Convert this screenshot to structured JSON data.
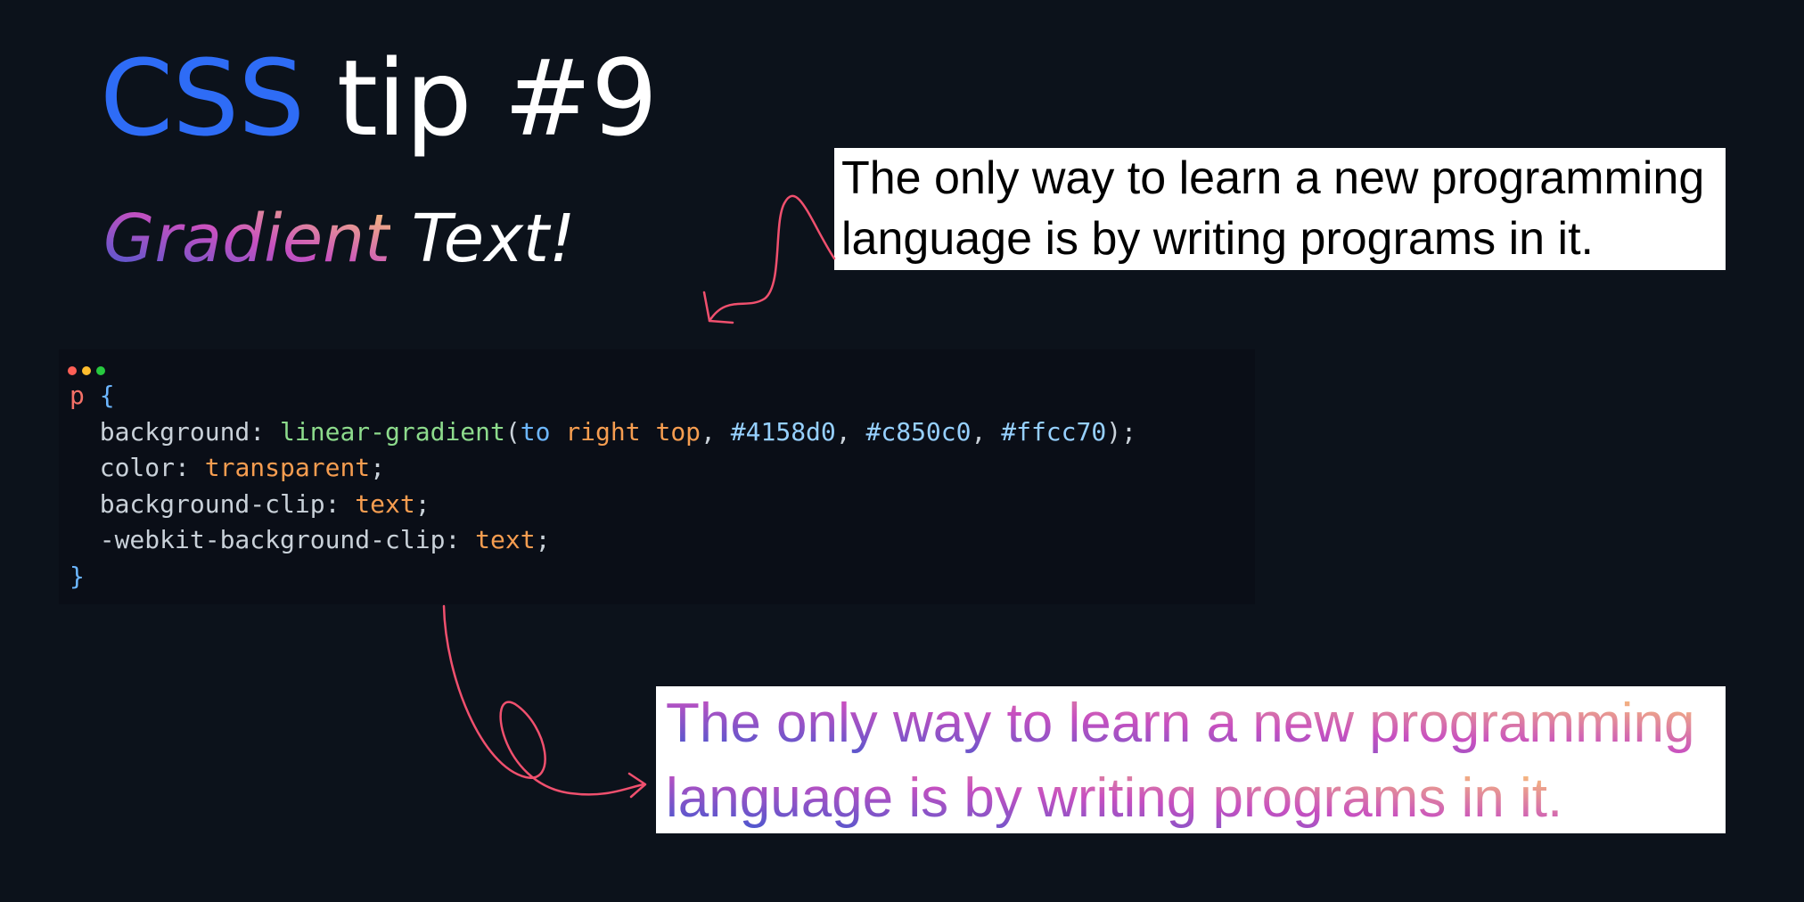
{
  "title": {
    "accent": "CSS",
    "rest": "tip #9"
  },
  "subtitle": {
    "gradient_word": "Gradient",
    "rest": "Text!"
  },
  "quote": {
    "line1": "The only way to learn a new programming",
    "line2": "language is by writing programs in it."
  },
  "code": {
    "selector": "p",
    "open_brace": "{",
    "close_brace": "}",
    "lines": [
      {
        "prop": "background",
        "parts": [
          {
            "text": "linear-gradient",
            "kind": "fn"
          },
          {
            "text": "(",
            "kind": "punc"
          },
          {
            "text": "to",
            "kind": "kw"
          },
          {
            "text": " right top",
            "kind": "val"
          },
          {
            "text": ", ",
            "kind": "punc"
          },
          {
            "text": "#4158d0",
            "kind": "hex"
          },
          {
            "text": ", ",
            "kind": "punc"
          },
          {
            "text": "#c850c0",
            "kind": "hex"
          },
          {
            "text": ", ",
            "kind": "punc"
          },
          {
            "text": "#ffcc70",
            "kind": "hex"
          },
          {
            "text": ");",
            "kind": "punc"
          }
        ]
      },
      {
        "prop": "color",
        "parts": [
          {
            "text": "transparent",
            "kind": "val"
          },
          {
            "text": ";",
            "kind": "punc"
          }
        ]
      },
      {
        "prop": "background-clip",
        "parts": [
          {
            "text": "text",
            "kind": "val"
          },
          {
            "text": ";",
            "kind": "punc"
          }
        ]
      },
      {
        "prop": "-webkit-background-clip",
        "parts": [
          {
            "text": "text",
            "kind": "val"
          },
          {
            "text": ";",
            "kind": "punc"
          }
        ]
      }
    ]
  },
  "colors": {
    "background": "#0c121b",
    "code_panel": "#0a0e17",
    "accent_blue": "#2e6cf6",
    "arrow": "#f0506e",
    "gradient": [
      "#4158d0",
      "#c850c0",
      "#ffcc70"
    ],
    "window_dots": [
      "#ff5f56",
      "#ffbd2e",
      "#27c93f"
    ],
    "syntax": {
      "selector": "#f47067",
      "brace": "#6cb6ff",
      "prop": "#c9d1d9",
      "fn": "#8ddb8c",
      "kw": "#6cb6ff",
      "val": "#f69d50",
      "hex": "#96d0ff",
      "punc": "#c9d1d9"
    }
  }
}
